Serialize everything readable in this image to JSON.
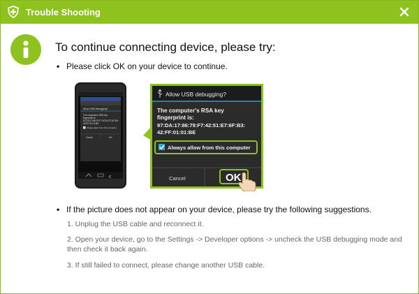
{
  "window": {
    "title": "Trouble Shooting",
    "accent_color": "#8dc21f"
  },
  "headline": "To continue connecting device, please try:",
  "bullet_1": "Please click OK on your device to continue.",
  "bullet_2": "If the picture does not appear on your device, please try the following suggestions.",
  "steps": [
    "1. Unplug the USB cable and reconnect it.",
    "2. Open your device, go to the Settings -> Developer options -> uncheck the USB debugging mode and then check it back again.",
    "3. If still failed to connect, please change another USB cable."
  ],
  "dialog": {
    "title": "Allow USB debugging?",
    "message_line1": "The computer's RSA key",
    "message_line2": "fingerprint is:",
    "fingerprint_line1": "97:DA:17:86:79:F7:42:51:E7:6F:B3:",
    "fingerprint_line2": "42:FF:01:01:BE",
    "checkbox_label": "Always allow from this computer",
    "cancel_label": "Cancel",
    "ok_label": "OK"
  },
  "phone_dialog": {
    "title": "Allow USB debugging?",
    "message_line1": "The computer's RSA key",
    "message_line2": "fingerprint is:",
    "fingerprint_line1": "97:DA:17:86:79:F7:42:51:E7:6F:B3:",
    "fingerprint_line2": "42:FF:01:01:BE",
    "checkbox_label": "Always allow from this computer",
    "cancel_label": "Cancel",
    "ok_label": "OK"
  }
}
